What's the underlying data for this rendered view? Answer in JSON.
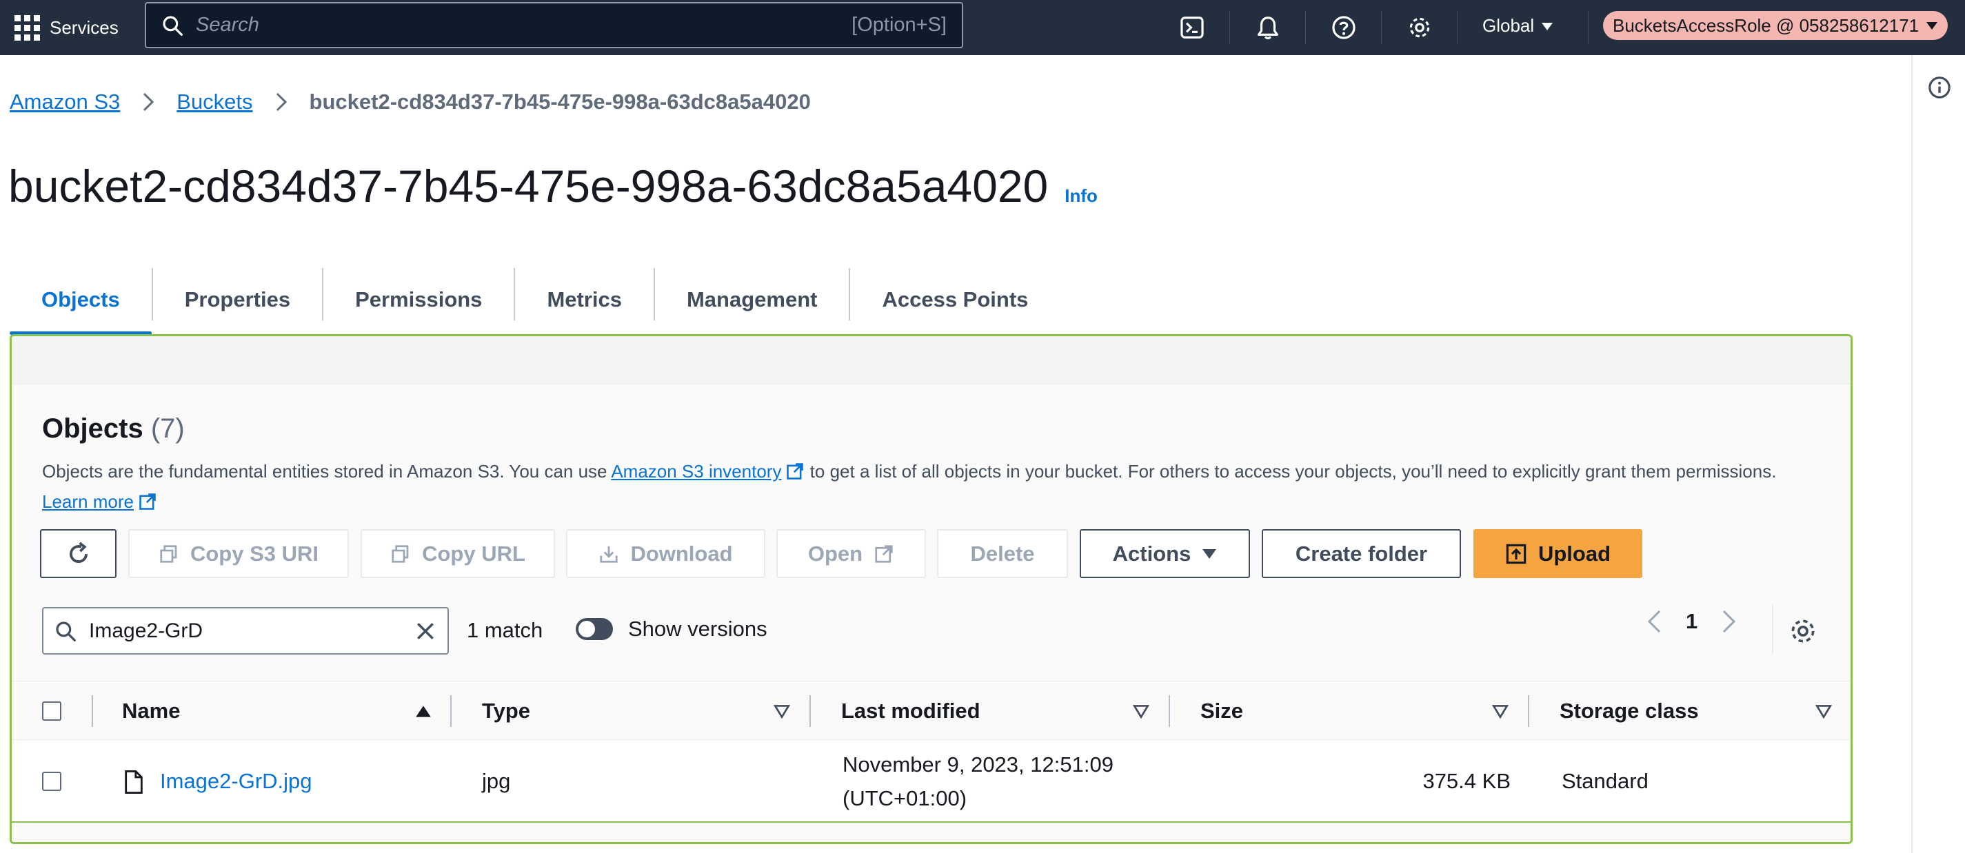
{
  "topnav": {
    "services_label": "Services",
    "search_placeholder": "Search",
    "search_shortcut": "[Option+S]",
    "region_label": "Global",
    "account_label": "BucketsAccessRole @ 058258612171"
  },
  "breadcrumb": {
    "items": [
      "Amazon S3",
      "Buckets"
    ],
    "current": "bucket2-cd834d37-7b45-475e-998a-63dc8a5a4020"
  },
  "page": {
    "title": "bucket2-cd834d37-7b45-475e-998a-63dc8a5a4020",
    "info_label": "Info"
  },
  "tabs": [
    {
      "label": "Objects",
      "active": true
    },
    {
      "label": "Properties"
    },
    {
      "label": "Permissions"
    },
    {
      "label": "Metrics"
    },
    {
      "label": "Management"
    },
    {
      "label": "Access Points"
    }
  ],
  "objects": {
    "heading": "Objects",
    "count": "(7)",
    "description_before": "Objects are the fundamental entities stored in Amazon S3. You can use ",
    "inventory_link": "Amazon S3 inventory",
    "description_after": " to get a list of all objects in your bucket. For others to access your objects, you’ll need to explicitly grant them permissions.",
    "learn_more": "Learn more"
  },
  "toolbar": {
    "copy_s3_uri": "Copy S3 URI",
    "copy_url": "Copy URL",
    "download": "Download",
    "open": "Open",
    "delete": "Delete",
    "actions": "Actions",
    "create_folder": "Create folder",
    "upload": "Upload"
  },
  "filter": {
    "value": "Image2-GrD",
    "match_text": "1 match",
    "show_versions_label": "Show versions",
    "show_versions_on": false
  },
  "pagination": {
    "current_page": "1"
  },
  "table": {
    "columns": [
      "Name",
      "Type",
      "Last modified",
      "Size",
      "Storage class"
    ],
    "rows": [
      {
        "name": "Image2-GrD.jpg",
        "type": "jpg",
        "last_modified_line1": "November 9, 2023, 12:51:09",
        "last_modified_line2": "(UTC+01:00)",
        "size": "375.4 KB",
        "storage_class": "Standard"
      }
    ]
  },
  "colors": {
    "nav_bg": "#232f3e",
    "link_blue": "#0972d3",
    "upload_orange": "#f5a442",
    "account_pill": "#f4b6b0",
    "panel_border_green": "#8bc34a"
  }
}
